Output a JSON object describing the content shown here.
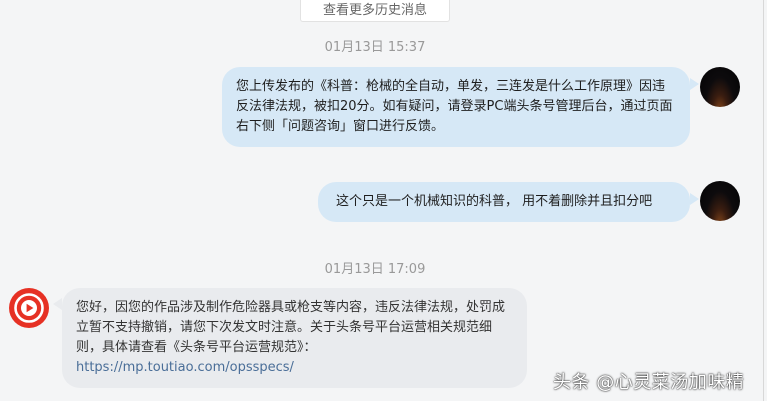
{
  "history_button": "查看更多历史消息",
  "messages": [
    {
      "timestamp": "01月13日 15:37",
      "text": "您上传发布的《科普：枪械的全自动，单发，三连发是什么工作原理》因违反法律法规，被扣20分。如有疑问，请登录PC端头条号管理后台，通过页面右下侧「问题咨询」窗口进行反馈。"
    },
    {
      "text": "这个只是一个机械知识的科普， 用不着删除并且扣分吧"
    },
    {
      "timestamp": "01月13日 17:09",
      "text": "您好，因您的作品涉及制作危险器具或枪支等内容，违反法律法规，处罚成立暂不支持撤销，请您下次发文时注意。关于头条号平台运营相关规范细则，具体请查看《头条号平台运营规范》：",
      "link": "https://mp.toutiao.com/opsspecs/"
    }
  ],
  "watermark": "头条 @心灵菜汤加味精",
  "colors": {
    "outgoing_bubble": "#d6e8f6",
    "incoming_bubble": "#e9ebee",
    "link": "#4a6e98",
    "brand_red": "#e63124"
  },
  "icons": {
    "user_avatar": "night-sky-avatar",
    "system_avatar": "play-button-logo"
  }
}
